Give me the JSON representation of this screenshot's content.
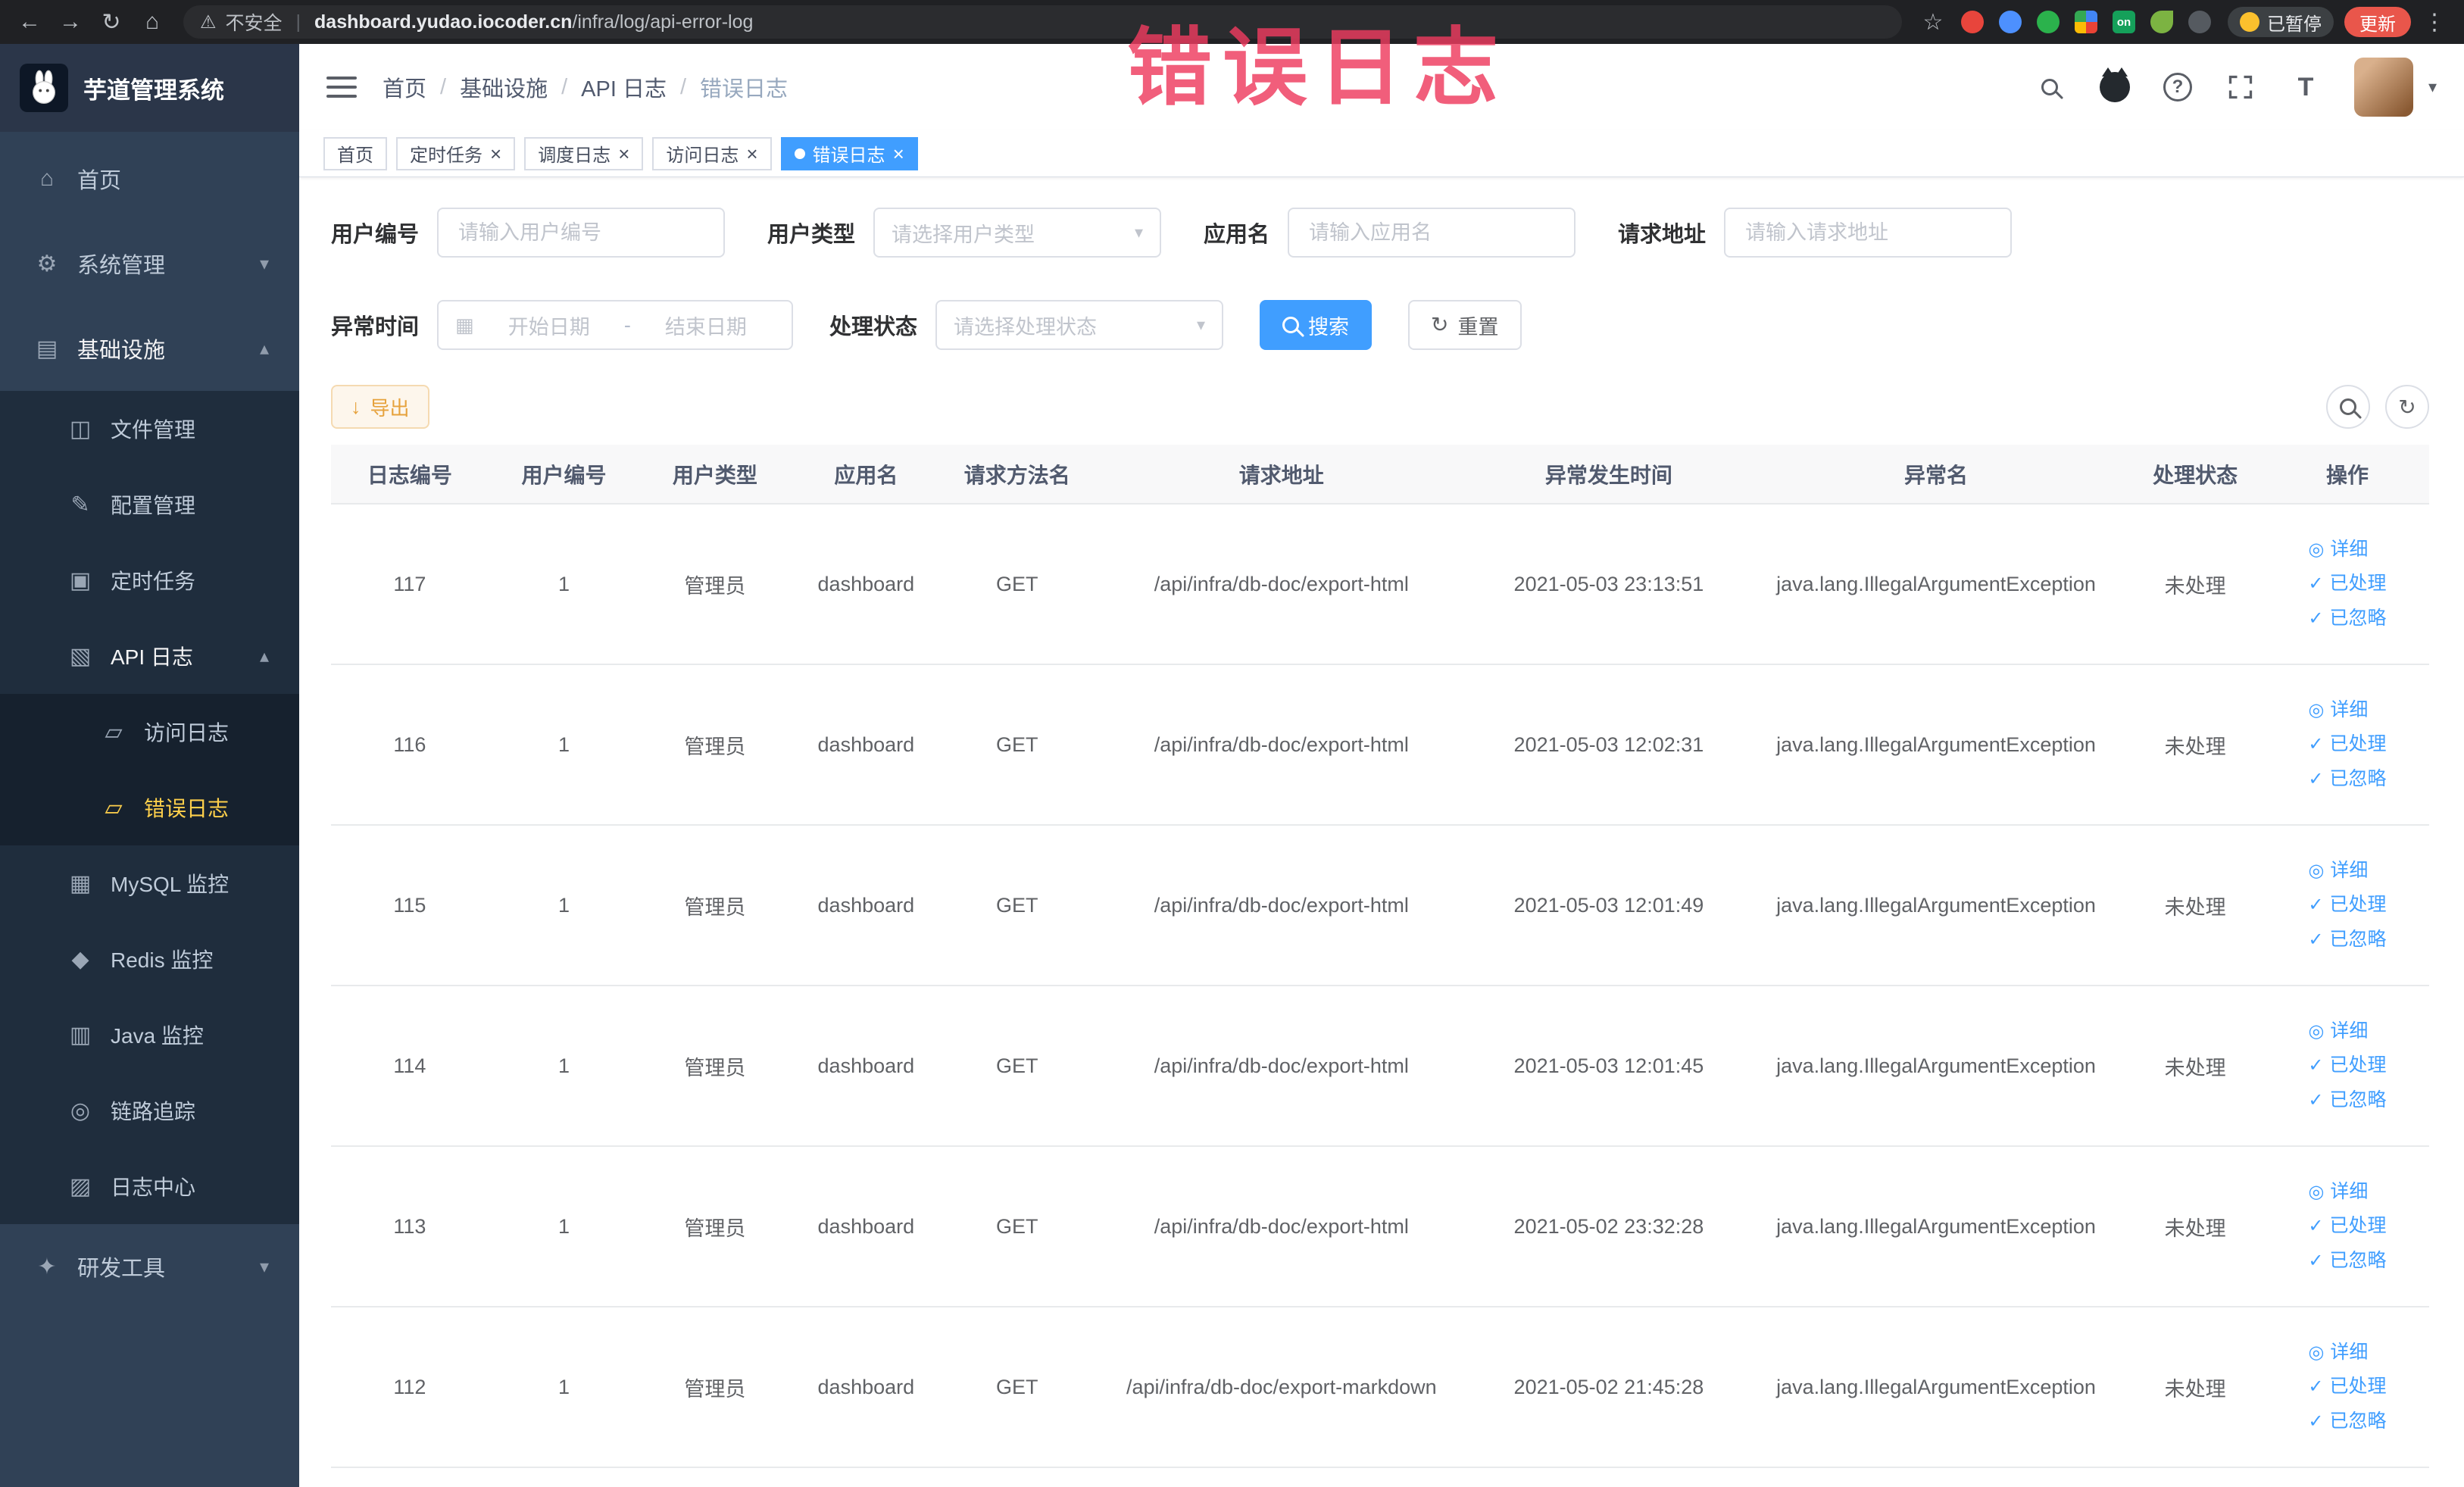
{
  "watermark": "错误日志",
  "colors": {
    "primary": "#409eff",
    "sidebar_bg": "#304156",
    "menu_active": "#ffd04b",
    "warning_text": "#e6a23c",
    "watermark": "#ee3b5f"
  },
  "browser": {
    "security_label": "不安全",
    "url_domain": "dashboard.yudao.iocoder.cn",
    "url_path": "/infra/log/api-error-log",
    "vpn_badge": "on",
    "paused_badge": "已暂停",
    "update_button": "更新"
  },
  "sidebar": {
    "logo_title": "芋道管理系统",
    "items": [
      {
        "key": "home",
        "label": "首页",
        "icon": "home",
        "level": 1
      },
      {
        "key": "system-mgmt",
        "label": "系统管理",
        "icon": "gear",
        "level": 1,
        "chevron": "down"
      },
      {
        "key": "infrastructure",
        "label": "基础设施",
        "icon": "infra",
        "level": 1,
        "chevron": "up",
        "expanded": true
      },
      {
        "key": "file-mgmt",
        "label": "文件管理",
        "icon": "file",
        "level": 2
      },
      {
        "key": "config-mgmt",
        "label": "配置管理",
        "icon": "config",
        "level": 2
      },
      {
        "key": "scheduled-task",
        "label": "定时任务",
        "icon": "task",
        "level": 2
      },
      {
        "key": "api-log",
        "label": "API 日志",
        "icon": "api-log",
        "level": 2,
        "chevron": "up",
        "expanded": true
      },
      {
        "key": "access-log",
        "label": "访问日志",
        "icon": "doc",
        "level": 3
      },
      {
        "key": "error-log",
        "label": "错误日志",
        "icon": "doc",
        "level": 3,
        "active": true
      },
      {
        "key": "mysql-monitor",
        "label": "MySQL 监控",
        "icon": "mysql",
        "level": 2
      },
      {
        "key": "redis-monitor",
        "label": "Redis 监控",
        "icon": "redis",
        "level": 2
      },
      {
        "key": "java-monitor",
        "label": "Java 监控",
        "icon": "java",
        "level": 2
      },
      {
        "key": "trace",
        "label": "链路追踪",
        "icon": "trace",
        "level": 2
      },
      {
        "key": "log-center",
        "label": "日志中心",
        "icon": "log-center",
        "level": 2
      },
      {
        "key": "dev-tools",
        "label": "研发工具",
        "icon": "tools",
        "level": 1,
        "chevron": "down"
      }
    ]
  },
  "header": {
    "breadcrumb": [
      "首页",
      "基础设施",
      "API 日志",
      "错误日志"
    ]
  },
  "tabs": [
    {
      "key": "home",
      "label": "首页",
      "closable": false,
      "active": false
    },
    {
      "key": "scheduled-task",
      "label": "定时任务",
      "closable": true,
      "active": false
    },
    {
      "key": "job-log",
      "label": "调度日志",
      "closable": true,
      "active": false
    },
    {
      "key": "access-log",
      "label": "访问日志",
      "closable": true,
      "active": false
    },
    {
      "key": "error-log",
      "label": "错误日志",
      "closable": true,
      "active": true
    }
  ],
  "filters": {
    "user_id": {
      "label": "用户编号",
      "placeholder": "请输入用户编号"
    },
    "user_type": {
      "label": "用户类型",
      "placeholder": "请选择用户类型"
    },
    "app_name": {
      "label": "应用名",
      "placeholder": "请输入应用名"
    },
    "request_url": {
      "label": "请求地址",
      "placeholder": "请输入请求地址"
    },
    "exception_time": {
      "label": "异常时间",
      "start_placeholder": "开始日期",
      "separator": "-",
      "end_placeholder": "结束日期"
    },
    "process_status": {
      "label": "处理状态",
      "placeholder": "请选择处理状态"
    },
    "search_button": "搜索",
    "reset_button": "重置"
  },
  "toolbar": {
    "export_label": "导出"
  },
  "table": {
    "headers": [
      "日志编号",
      "用户编号",
      "用户类型",
      "应用名",
      "请求方法名",
      "请求地址",
      "异常发生时间",
      "异常名",
      "处理状态",
      "操作"
    ],
    "row_actions": [
      {
        "key": "detail",
        "label": "详细",
        "icon": "eye"
      },
      {
        "key": "processed",
        "label": "已处理",
        "icon": "check"
      },
      {
        "key": "ignored",
        "label": "已忽略",
        "icon": "check"
      }
    ],
    "rows": [
      {
        "id": "117",
        "user_id": "1",
        "user_type": "管理员",
        "app": "dashboard",
        "method": "GET",
        "url": "/api/infra/db-doc/export-html",
        "time": "2021-05-03 23:13:51",
        "exception": "java.lang.IllegalArgumentException",
        "status": "未处理"
      },
      {
        "id": "116",
        "user_id": "1",
        "user_type": "管理员",
        "app": "dashboard",
        "method": "GET",
        "url": "/api/infra/db-doc/export-html",
        "time": "2021-05-03 12:02:31",
        "exception": "java.lang.IllegalArgumentException",
        "status": "未处理"
      },
      {
        "id": "115",
        "user_id": "1",
        "user_type": "管理员",
        "app": "dashboard",
        "method": "GET",
        "url": "/api/infra/db-doc/export-html",
        "time": "2021-05-03 12:01:49",
        "exception": "java.lang.IllegalArgumentException",
        "status": "未处理"
      },
      {
        "id": "114",
        "user_id": "1",
        "user_type": "管理员",
        "app": "dashboard",
        "method": "GET",
        "url": "/api/infra/db-doc/export-html",
        "time": "2021-05-03 12:01:45",
        "exception": "java.lang.IllegalArgumentException",
        "status": "未处理"
      },
      {
        "id": "113",
        "user_id": "1",
        "user_type": "管理员",
        "app": "dashboard",
        "method": "GET",
        "url": "/api/infra/db-doc/export-html",
        "time": "2021-05-02 23:32:28",
        "exception": "java.lang.IllegalArgumentException",
        "status": "未处理"
      },
      {
        "id": "112",
        "user_id": "1",
        "user_type": "管理员",
        "app": "dashboard",
        "method": "GET",
        "url": "/api/infra/db-doc/export-markdown",
        "time": "2021-05-02 21:45:28",
        "exception": "java.lang.IllegalArgumentException",
        "status": "未处理"
      }
    ]
  }
}
